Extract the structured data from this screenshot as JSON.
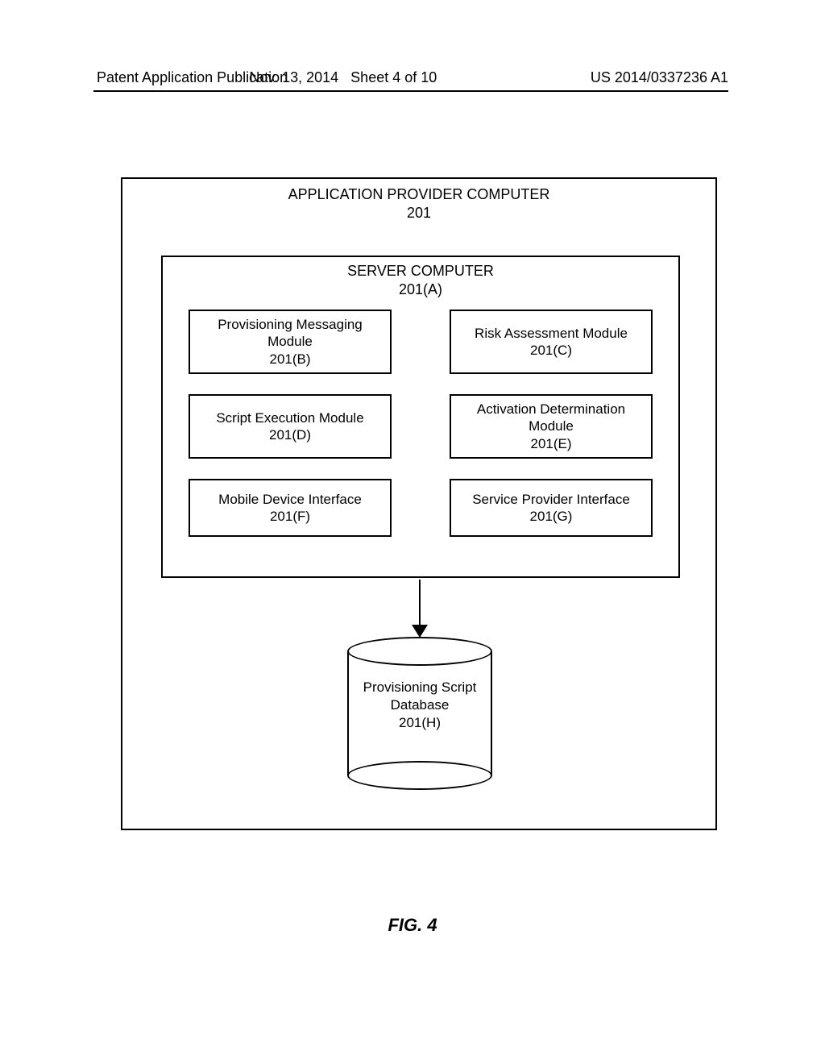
{
  "header": {
    "left": "Patent Application Publication",
    "date": "Nov. 13, 2014",
    "sheet": "Sheet 4 of 10",
    "pubno": "US 2014/0337236 A1"
  },
  "outer": {
    "title": "APPLICATION PROVIDER COMPUTER",
    "ref": "201"
  },
  "server": {
    "title": "SERVER COMPUTER",
    "ref": "201(A)"
  },
  "modules": {
    "b": {
      "label": "Provisioning Messaging Module",
      "ref": "201(B)"
    },
    "c": {
      "label": "Risk Assessment Module",
      "ref": "201(C)"
    },
    "d": {
      "label": "Script Execution Module",
      "ref": "201(D)"
    },
    "e": {
      "label": "Activation Determination Module",
      "ref": "201(E)"
    },
    "f": {
      "label": "Mobile Device Interface",
      "ref": "201(F)"
    },
    "g": {
      "label": "Service Provider Interface",
      "ref": "201(G)"
    }
  },
  "database": {
    "label": "Provisioning Script Database",
    "ref": "201(H)"
  },
  "figure": "FIG. 4"
}
